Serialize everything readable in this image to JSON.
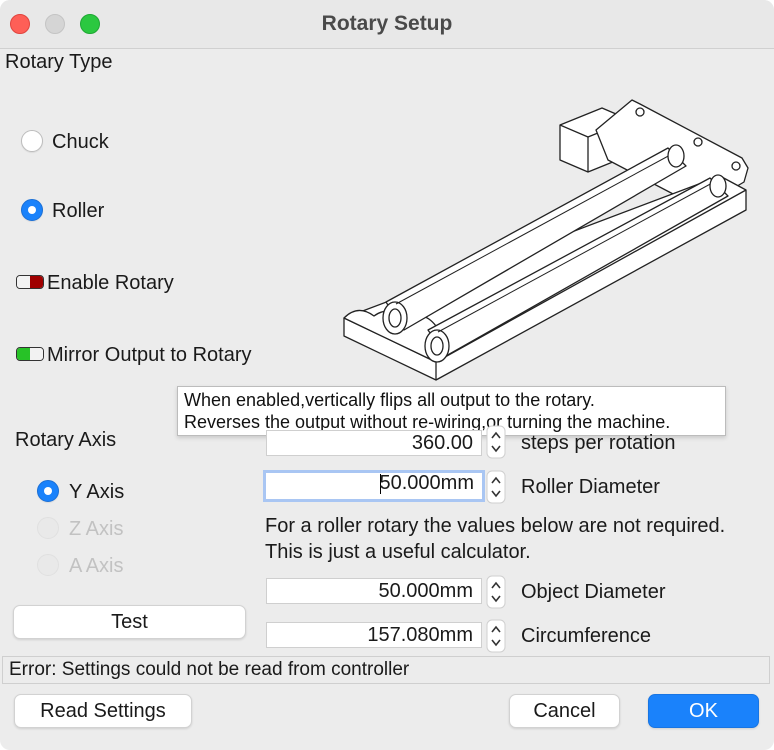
{
  "window": {
    "title": "Rotary Setup"
  },
  "rotary_type": {
    "heading": "Rotary Type",
    "options": [
      {
        "label": "Chuck",
        "selected": false
      },
      {
        "label": "Roller",
        "selected": true
      }
    ]
  },
  "toggles": {
    "enable_rotary": {
      "label": "Enable Rotary",
      "on": false,
      "color": "#a00000"
    },
    "mirror_output": {
      "label": "Mirror Output to Rotary",
      "on": true,
      "color": "#27c227"
    }
  },
  "tooltip": {
    "line1": "When enabled,vertically flips all output to the rotary.",
    "line2": "Reverses the output without re-wiring,or turning the machine."
  },
  "rotary_axis": {
    "heading": "Rotary Axis",
    "options": [
      {
        "label": "Y Axis",
        "selected": true,
        "enabled": true
      },
      {
        "label": "Z Axis",
        "selected": false,
        "enabled": false
      },
      {
        "label": "A Axis",
        "selected": false,
        "enabled": false
      }
    ]
  },
  "fields": {
    "steps": {
      "value": "360.00",
      "label": "steps per rotation"
    },
    "roller_diameter": {
      "value": "50.000mm",
      "label": "Roller Diameter"
    },
    "object_diameter": {
      "value": "50.000mm",
      "label": "Object Diameter"
    },
    "circumference": {
      "value": "157.080mm",
      "label": "Circumference"
    }
  },
  "note": {
    "line1": "For a roller rotary the values below are not required.",
    "line2": "This is just a useful calculator."
  },
  "buttons": {
    "test": "Test",
    "read_settings": "Read Settings",
    "cancel": "Cancel",
    "ok": "OK"
  },
  "status": "Error: Settings could not be read from controller",
  "colors": {
    "accent": "#1a82fb"
  }
}
